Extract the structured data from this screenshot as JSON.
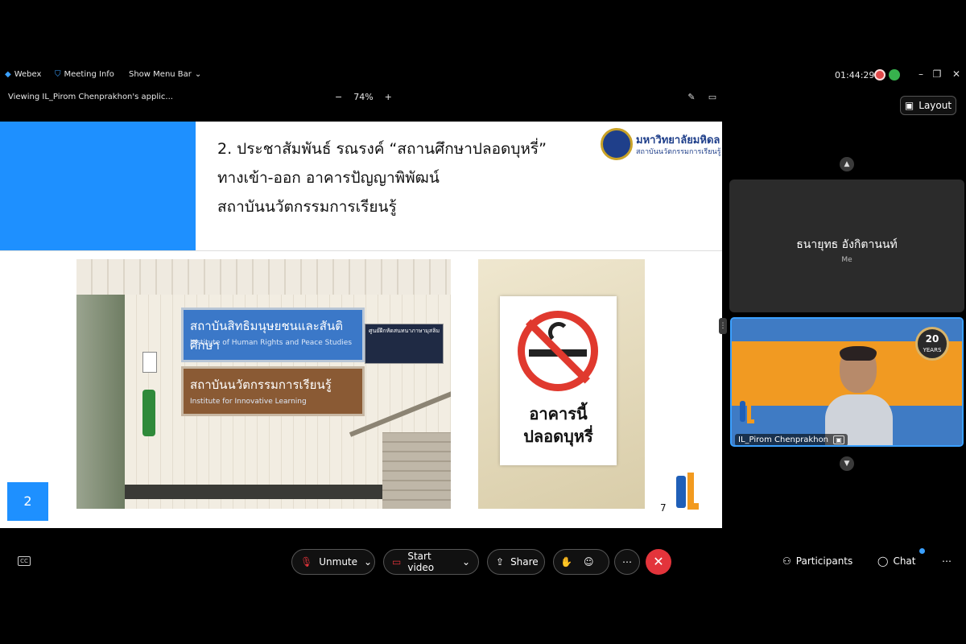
{
  "titlebar": {
    "app_name": "Webex",
    "meeting_info": "Meeting Info",
    "show_menu_bar": "Show Menu Bar",
    "timer": "01:44:29"
  },
  "share_bar": {
    "viewing": "Viewing IL_Pirom Chenprakhon's applic...",
    "zoom_minus": "−",
    "zoom_level": "74%",
    "zoom_plus": "+"
  },
  "layout_button": "Layout",
  "slide": {
    "title_lines": [
      "2. ประชาสัมพันธ์ รณรงค์ “สถานศึกษาปลอดบุหรี่”",
      "ทางเข้า-ออก อาคารปัญญาพิพัฒน์",
      "สถาบันนวัตกรรมการเรียนรู้"
    ],
    "logo_title": "มหาวิทยาลัยมหิดล",
    "logo_subtitle": "สถาบันนวัตกรรมการเรียนรู้",
    "sign1_thai": "สถาบันสิทธิมนุษยชนและสันติศึกษา",
    "sign1_en": "Institute of Human Rights and Peace Studies",
    "sign2_thai": "สถาบันนวัตกรรมการเรียนรู้",
    "sign2_en": "Institute for Innovative Learning",
    "notice_title": "ศูนย์ฝึกหัดสนทนาภาษามุสลิม",
    "nosmoke_line1": "อาคารนี้",
    "nosmoke_line2": "ปลอดบุหรี่",
    "slide_number_box": "2",
    "page_number": "7"
  },
  "participants": [
    {
      "name": "ธนายุทธ อังกิตานนท์",
      "sub": "Me"
    },
    {
      "name": "IL_Pirom Chenprakhon"
    }
  ],
  "video_badge": {
    "line1": "20",
    "line2": "YEARS"
  },
  "controls": {
    "unmute": "Unmute",
    "start_video": "Start video",
    "share": "Share",
    "participants": "Participants",
    "chat": "Chat"
  },
  "colors": {
    "accent": "#1e90ff",
    "end_call": "#e3343b",
    "video_orange": "#f19a22"
  }
}
